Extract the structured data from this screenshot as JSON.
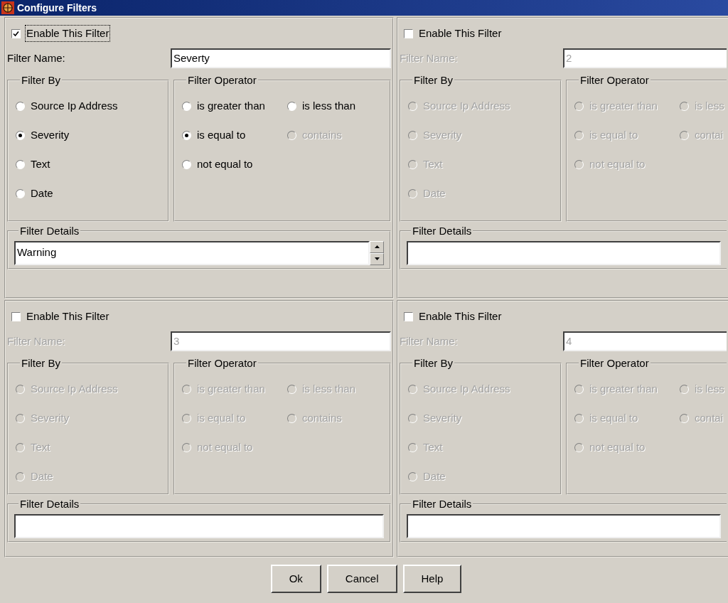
{
  "window": {
    "title": "Configure Filters"
  },
  "filters": [
    {
      "enable_label": "Enable This Filter",
      "enabled": true,
      "focused": true,
      "name_label": "Filter Name:",
      "name_value": "Severty",
      "filter_by": {
        "title": "Filter By",
        "options": [
          {
            "label": "Source Ip Address",
            "selected": false
          },
          {
            "label": "Severity",
            "selected": true
          },
          {
            "label": "Text",
            "selected": false
          },
          {
            "label": "Date",
            "selected": false
          }
        ]
      },
      "operator": {
        "title": "Filter Operator",
        "options": [
          {
            "label": "is greater than",
            "selected": false,
            "disabled": false
          },
          {
            "label": "is less than",
            "selected": false,
            "disabled": false
          },
          {
            "label": "is equal to",
            "selected": true,
            "disabled": false
          },
          {
            "label": "contains",
            "selected": false,
            "disabled": true
          },
          {
            "label": "not equal to",
            "selected": false,
            "disabled": false
          }
        ]
      },
      "details": {
        "title": "Filter Details",
        "value": "Warning",
        "spinner": true
      }
    },
    {
      "enable_label": "Enable This Filter",
      "enabled": false,
      "focused": false,
      "name_label": "Filter Name:",
      "name_value": "2",
      "filter_by": {
        "title": "Filter By",
        "options": [
          {
            "label": "Source Ip Address",
            "selected": false
          },
          {
            "label": "Severity",
            "selected": false
          },
          {
            "label": "Text",
            "selected": false
          },
          {
            "label": "Date",
            "selected": false
          }
        ]
      },
      "operator": {
        "title": "Filter Operator",
        "options": [
          {
            "label": "is greater than",
            "selected": false
          },
          {
            "label": "is less",
            "selected": false
          },
          {
            "label": "is equal to",
            "selected": false
          },
          {
            "label": "contai",
            "selected": false
          },
          {
            "label": "not equal to",
            "selected": false
          }
        ]
      },
      "details": {
        "title": "Filter Details",
        "spinner": false
      }
    },
    {
      "enable_label": "Enable This Filter",
      "enabled": false,
      "focused": false,
      "name_label": "Filter Name:",
      "name_value": "3",
      "filter_by": {
        "title": "Filter By",
        "options": [
          {
            "label": "Source Ip Address",
            "selected": false
          },
          {
            "label": "Severity",
            "selected": false
          },
          {
            "label": "Text",
            "selected": false
          },
          {
            "label": "Date",
            "selected": false
          }
        ]
      },
      "operator": {
        "title": "Filter Operator",
        "options": [
          {
            "label": "is greater than",
            "selected": false
          },
          {
            "label": "is less than",
            "selected": false
          },
          {
            "label": "is equal to",
            "selected": false
          },
          {
            "label": "contains",
            "selected": false
          },
          {
            "label": "not equal to",
            "selected": false
          }
        ]
      },
      "details": {
        "title": "Filter Details",
        "spinner": false
      }
    },
    {
      "enable_label": "Enable This Filter",
      "enabled": false,
      "focused": false,
      "name_label": "Filter Name:",
      "name_value": "4",
      "filter_by": {
        "title": "Filter By",
        "options": [
          {
            "label": "Source Ip Address",
            "selected": false
          },
          {
            "label": "Severity",
            "selected": false
          },
          {
            "label": "Text",
            "selected": false
          },
          {
            "label": "Date",
            "selected": false
          }
        ]
      },
      "operator": {
        "title": "Filter Operator",
        "options": [
          {
            "label": "is greater than",
            "selected": false
          },
          {
            "label": "is less",
            "selected": false
          },
          {
            "label": "is equal to",
            "selected": false
          },
          {
            "label": "contai",
            "selected": false
          },
          {
            "label": "not equal to",
            "selected": false
          }
        ]
      },
      "details": {
        "title": "Filter Details",
        "spinner": false
      }
    }
  ],
  "buttons": [
    {
      "label": "Ok"
    },
    {
      "label": "Cancel"
    },
    {
      "label": "Help"
    }
  ]
}
